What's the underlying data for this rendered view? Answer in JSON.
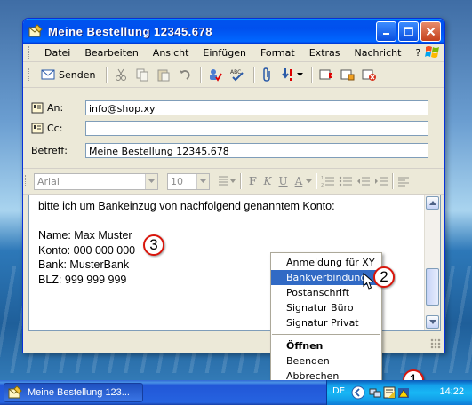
{
  "window": {
    "title": "Meine Bestellung 12345.678"
  },
  "menu": [
    "Datei",
    "Bearbeiten",
    "Ansicht",
    "Einfügen",
    "Format",
    "Extras",
    "Nachricht",
    "?"
  ],
  "toolbar": {
    "send_label": "Senden"
  },
  "header_fields": {
    "to_label": "An:",
    "to_value": "info@shop.xy",
    "cc_label": "Cc:",
    "cc_value": "",
    "subject_label": "Betreff:",
    "subject_value": "Meine Bestellung 12345.678"
  },
  "format_bar": {
    "font": "Arial",
    "size": "10"
  },
  "body": {
    "lines": [
      "bitte ich um Bankeinzug von nachfolgend genanntem Konto:",
      "",
      "Name: Max Muster",
      "Konto: 000 000 000",
      "Bank: MusterBank",
      "BLZ: 999 999 999"
    ]
  },
  "context_menu": {
    "items": [
      "Anmeldung für XY",
      "Bankverbindung",
      "Postanschrift",
      "Signatur Büro",
      "Signatur Privat"
    ],
    "highlighted_index": 1,
    "actions": [
      "Öffnen",
      "Beenden",
      "Abbrechen"
    ]
  },
  "callouts": [
    "1",
    "2",
    "3"
  ],
  "taskbar": {
    "task_label": "Meine Bestellung 123...",
    "language": "DE",
    "clock": "14:22"
  },
  "colors": {
    "highlight": "#316ac5",
    "callout_border": "#d9160c",
    "titlebar": "#0053ee"
  }
}
